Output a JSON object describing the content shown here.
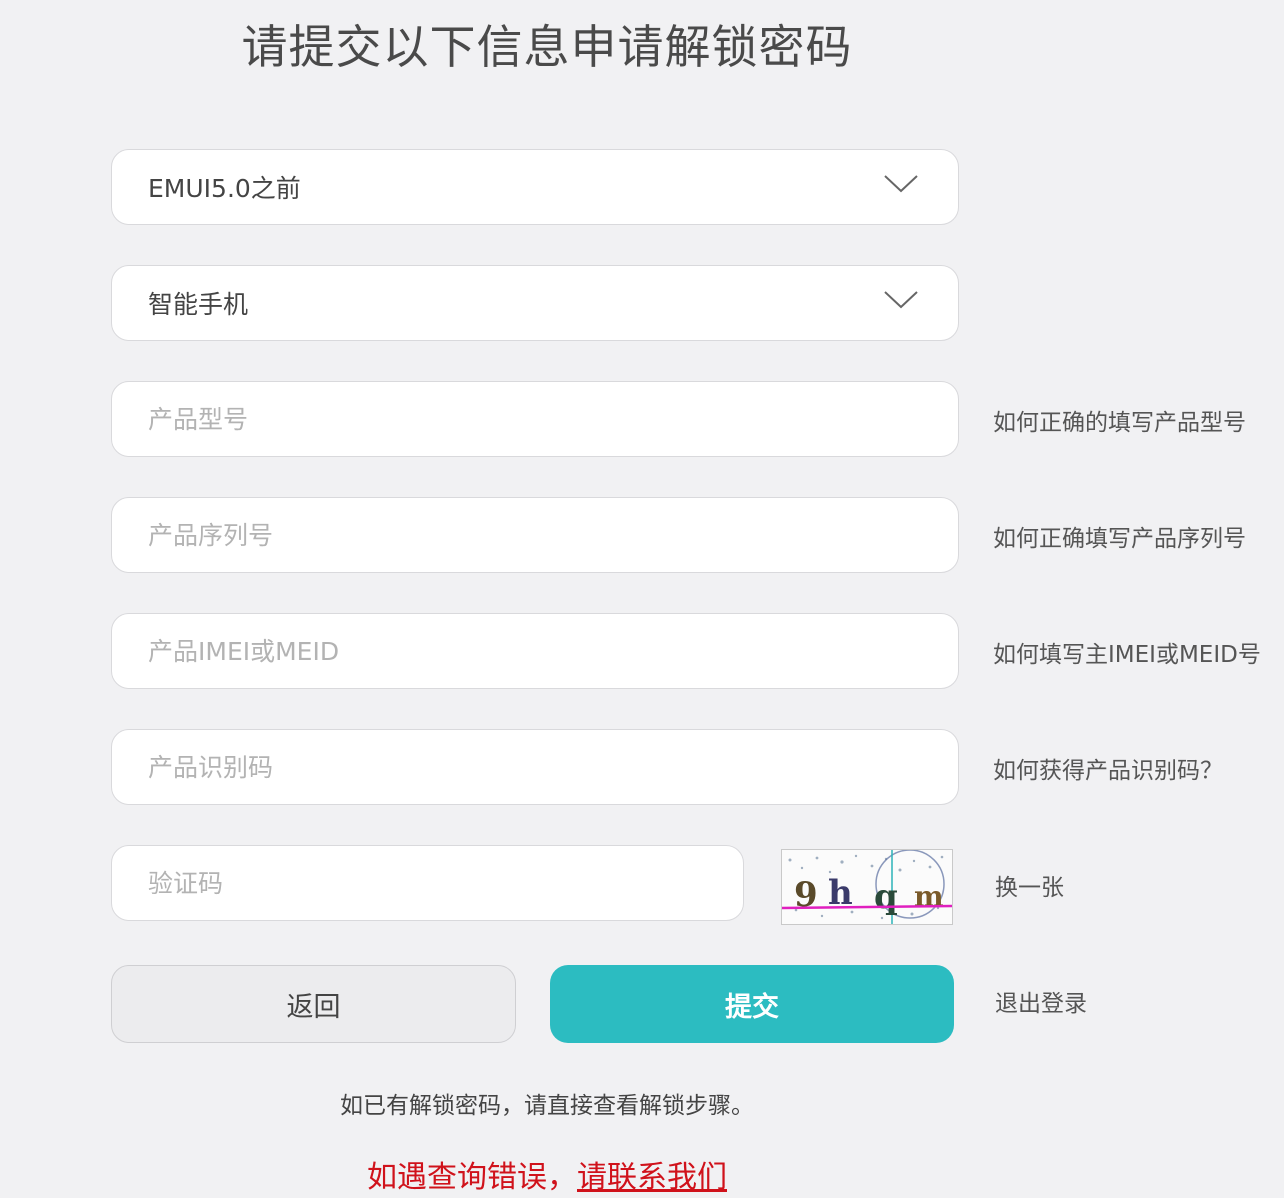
{
  "title": "请提交以下信息申请解锁密码",
  "selects": {
    "emui_version": {
      "value": "EMUI5.0之前"
    },
    "device_type": {
      "value": "智能手机"
    }
  },
  "inputs": {
    "model": {
      "placeholder": "产品型号",
      "value": ""
    },
    "serial": {
      "placeholder": "产品序列号",
      "value": ""
    },
    "imei": {
      "placeholder": "产品IMEI或MEID",
      "value": ""
    },
    "product_id": {
      "placeholder": "产品识别码",
      "value": ""
    },
    "captcha": {
      "placeholder": "验证码",
      "value": ""
    }
  },
  "help_links": {
    "model": "如何正确的填写产品型号",
    "serial": "如何正确填写产品序列号",
    "imei": "如何填写主IMEI或MEID号",
    "product_id": "如何获得产品识别码？"
  },
  "captcha": {
    "refresh_label": "换一张"
  },
  "buttons": {
    "back": "返回",
    "submit": "提交",
    "logout": "退出登录"
  },
  "note": "如已有解锁密码，请直接查看解锁步骤。",
  "contact": {
    "prefix": "如遇查询错误，",
    "link": "请联系我们"
  },
  "colors": {
    "accent": "#2cbcc1",
    "warning": "#d0121b",
    "background": "#f1f1f3"
  }
}
